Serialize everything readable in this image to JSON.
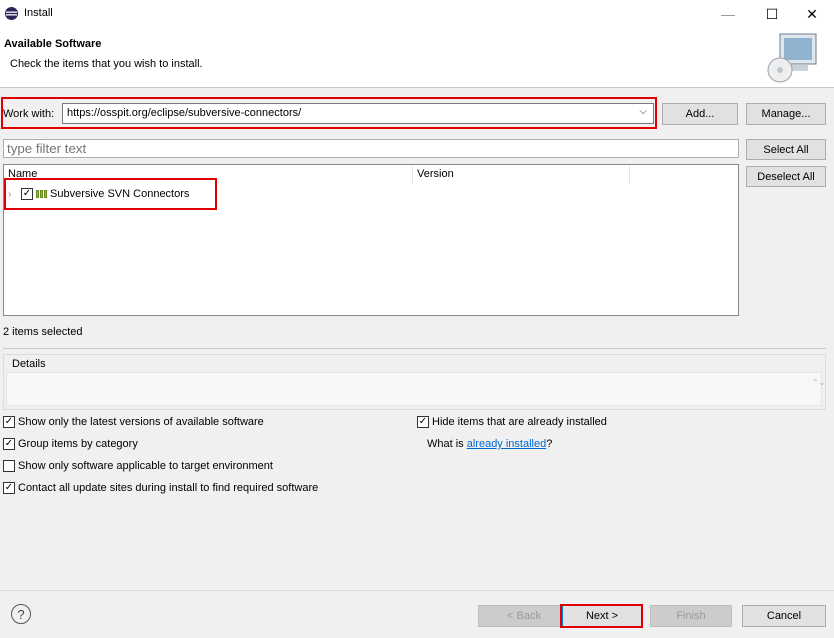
{
  "window": {
    "title": "Install",
    "min_icon": "minimize-icon",
    "max_icon": "maximize-icon",
    "close_icon": "close-icon",
    "close_glyph": "✕",
    "max_glyph": "☐",
    "min_glyph": "—"
  },
  "header": {
    "title": "Available Software",
    "description": "Check the items that you wish to install."
  },
  "work_with": {
    "label": "Work with:",
    "value": "https://osspit.org/eclipse/subversive-connectors/",
    "dropdown_glyph": "⌵",
    "add_label": "Add...",
    "manage_label": "Manage..."
  },
  "filter": {
    "placeholder": "type filter text",
    "select_all_label": "Select All",
    "deselect_all_label": "Deselect All"
  },
  "tree": {
    "columns": [
      "Name",
      "Version"
    ],
    "rows": [
      {
        "label": "Subversive SVN Connectors",
        "version": "",
        "checked": true,
        "expand_glyph": "›",
        "check_glyph": "✓"
      }
    ]
  },
  "status": {
    "selected_count": "2 items selected"
  },
  "details": {
    "label": "Details",
    "scroll_glyph": "⌃⌄"
  },
  "options": [
    {
      "label": "Show only the latest versions of available software",
      "checked": true
    },
    {
      "label": "Group items by category",
      "checked": true
    },
    {
      "label": "Show only software applicable to target environment",
      "checked": false
    },
    {
      "label": "Contact all update sites during install to find required software",
      "checked": true
    },
    {
      "label": "Hide items that are already installed",
      "checked": true
    }
  ],
  "installed_info": {
    "prefix": "What is ",
    "link": "already installed",
    "suffix": "?"
  },
  "footer": {
    "help_glyph": "?",
    "back_label": "< Back",
    "next_label": "Next >",
    "finish_label": "Finish",
    "cancel_label": "Cancel"
  },
  "colors": {
    "highlight": "#e00000",
    "link": "#0066cc",
    "dialog_bg": "#f0f0f0"
  }
}
